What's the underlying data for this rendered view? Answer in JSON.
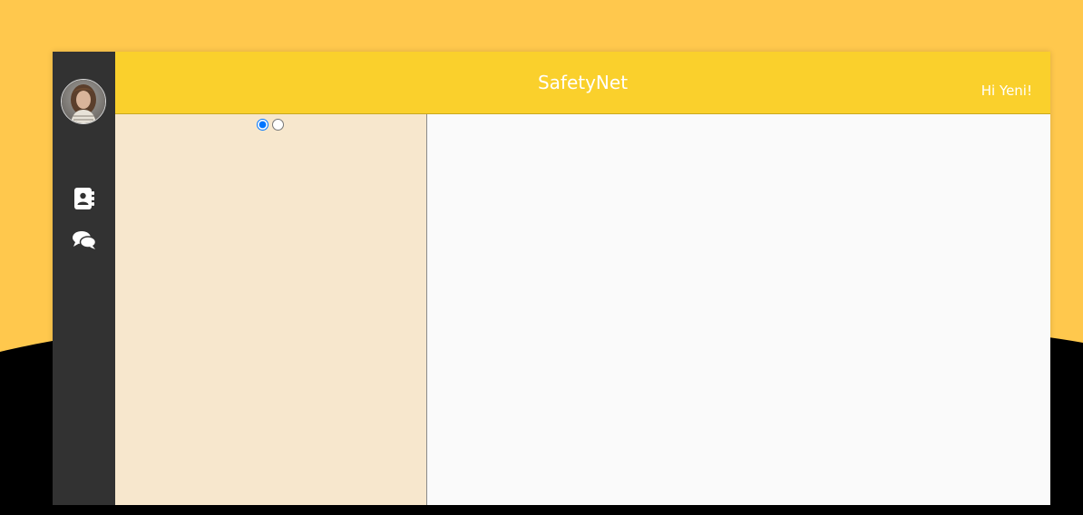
{
  "header": {
    "title": "SafetyNet",
    "greeting": "Hi Yeni!"
  },
  "sidebar": {
    "avatar_alt": "user-avatar",
    "items": [
      {
        "icon": "address-book-icon"
      },
      {
        "icon": "chat-bubbles-icon"
      }
    ]
  },
  "filters": {
    "radio_options": [
      {
        "selected": true
      },
      {
        "selected": false
      }
    ]
  },
  "colors": {
    "background": "#ffc84d",
    "sidebar": "#323232",
    "header": "#fad02c",
    "left_panel": "#f7e7cd",
    "right_panel": "#fafafa",
    "radio_selected": "#1a73e8"
  }
}
